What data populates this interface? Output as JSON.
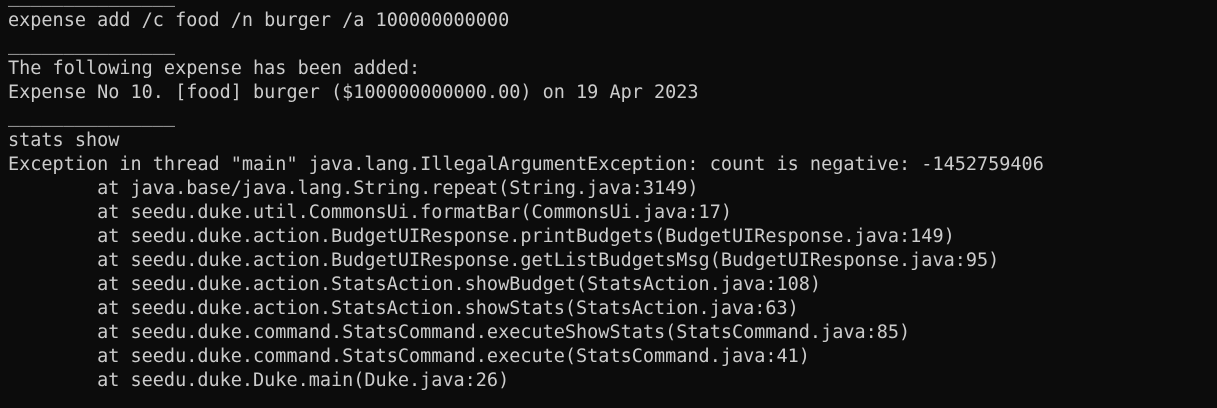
{
  "terminal": {
    "lines": [
      "_______________",
      "expense add /c food /n burger /a 100000000000",
      "_______________",
      "The following expense has been added:",
      "Expense No 10. [food] burger ($100000000000.00) on 19 Apr 2023",
      "_______________",
      "stats show",
      "Exception in thread \"main\" java.lang.IllegalArgumentException: count is negative: -1452759406",
      "        at java.base/java.lang.String.repeat(String.java:3149)",
      "        at seedu.duke.util.CommonsUi.formatBar(CommonsUi.java:17)",
      "        at seedu.duke.action.BudgetUIResponse.printBudgets(BudgetUIResponse.java:149)",
      "        at seedu.duke.action.BudgetUIResponse.getListBudgetsMsg(BudgetUIResponse.java:95)",
      "        at seedu.duke.action.StatsAction.showBudget(StatsAction.java:108)",
      "        at seedu.duke.action.StatsAction.showStats(StatsAction.java:63)",
      "        at seedu.duke.command.StatsCommand.executeShowStats(StatsCommand.java:85)",
      "        at seedu.duke.command.StatsCommand.execute(StatsCommand.java:41)",
      "        at seedu.duke.Duke.main(Duke.java:26)"
    ]
  },
  "colors": {
    "background": "#0c0c0c",
    "foreground": "#cccccc"
  }
}
